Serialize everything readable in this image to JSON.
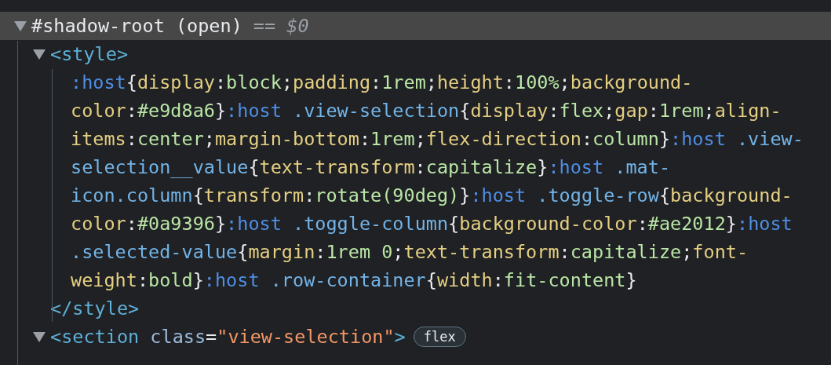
{
  "shadow_root": {
    "label": "#shadow-root (open)",
    "expanded": true,
    "selected": true,
    "console_ref": "== $0"
  },
  "style_element": {
    "open_tag": "<style>",
    "expanded": true,
    "css_lines": [
      ":host{display:block;padding:1rem;height:100%;background-",
      "color:#e9d8a6}:host .view-selection{display:flex;gap:1rem;align-",
      "items:center;margin-bottom:1rem;flex-direction:column}:host .view-",
      "selection__value{text-transform:capitalize}:host .mat-",
      "icon.column{transform:rotate(90deg)}:host .toggle-row{background-",
      "color:#0a9396}:host .toggle-column{background-color:#ae2012}:host",
      ".selected-value{margin:1rem 0;text-transform:capitalize;font-",
      "weight:bold}:host .row-container{width:fit-content}"
    ],
    "close_tag": "</style>"
  },
  "section_element": {
    "expanded": true,
    "selected": false,
    "open_tag_parts": [
      {
        "kind": "tag",
        "text": "<section"
      },
      {
        "kind": "attr-name",
        "text": " class"
      },
      {
        "kind": "punct",
        "text": "="
      },
      {
        "kind": "attr-value",
        "text": "\"view-selection\""
      },
      {
        "kind": "tag",
        "text": ">"
      }
    ],
    "badge": "flex"
  }
}
